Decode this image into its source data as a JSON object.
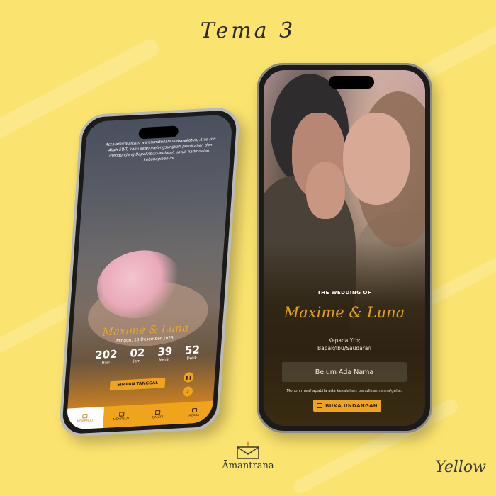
{
  "page": {
    "title": "Tema 3",
    "theme_name": "Yellow",
    "brand": "Āmantrana",
    "background_color": "#fbe36f",
    "accent_color": "#f0a41c",
    "script_color": "#e3a11d"
  },
  "cover": {
    "subtitle": "THE WEDDING OF",
    "couple": "Maxime & Luna",
    "recipient_line1": "Kepada Yth;",
    "recipient_line2": "Bapak/Ibu/Saudara/i",
    "guest_name": "Belum Ada Nama",
    "apology": "Mohon maaf apabila ada kesalahan penulisan nama/gelar.",
    "open_button": "BUKA UNDANGAN"
  },
  "home": {
    "greeting": "Assalamu'alaikum warahmatullahi wabarakatuh, Atas izin Allah SWT, kami akan melangsungkan pernikahan dan mengundang Bapak/Ibu/Saudara/i untuk hadir dalam kebahagiaan ini.",
    "couple": "Maxime & Luna",
    "date": "Minggu, 10 Desember 2025",
    "countdown": [
      {
        "value": "202",
        "label": "Hari"
      },
      {
        "value": "02",
        "label": "Jam"
      },
      {
        "value": "39",
        "label": "Menit"
      },
      {
        "value": "52",
        "label": "Detik"
      }
    ],
    "save_button": "SIMPAN TANGGAL",
    "nav": [
      {
        "label": "MEMPELAI",
        "icon": "home-icon"
      },
      {
        "label": "MEMPELAI",
        "icon": "couple-icon"
      },
      {
        "label": "GALERI",
        "icon": "gallery-icon"
      },
      {
        "label": "ACARA",
        "icon": "calendar-icon"
      }
    ]
  }
}
